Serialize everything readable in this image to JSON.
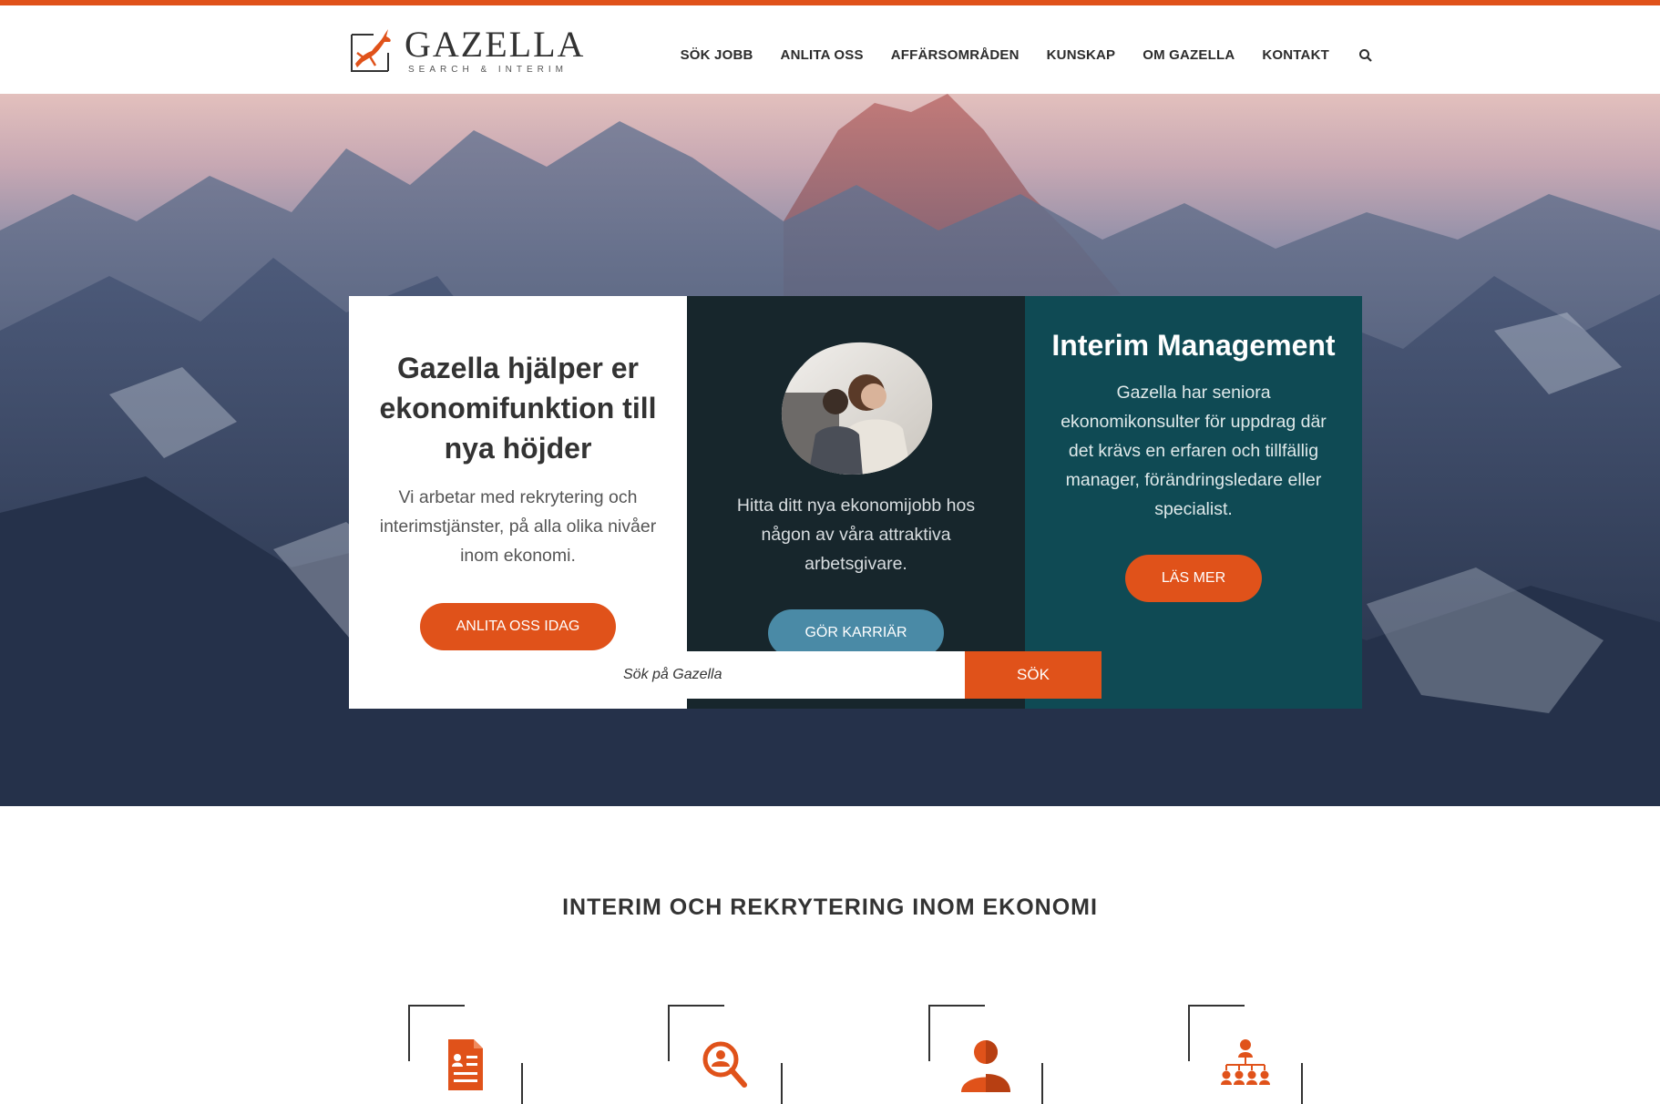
{
  "header": {
    "logo_name": "GAZELLA",
    "logo_sub": "SEARCH & INTERIM",
    "nav": [
      "SÖK JOBB",
      "ANLITA OSS",
      "AFFÄRSOMRÅDEN",
      "KUNSKAP",
      "OM GAZELLA",
      "KONTAKT"
    ],
    "search_icon": "search-icon"
  },
  "hero": {
    "card1": {
      "title": "Gazella hjälper er ekonomifunktion till nya höjder",
      "text": "Vi arbetar med rekrytering och interimstjänster, på alla olika nivåer inom ekonomi.",
      "button": "ANLITA OSS IDAG"
    },
    "card2": {
      "text": "Hitta ditt nya ekonomijobb hos någon av våra attraktiva arbetsgivare.",
      "button": "GÖR KARRIÄR"
    },
    "card3": {
      "title": "Interim Management",
      "text": "Gazella har seniora ekonomikonsulter för uppdrag där det krävs en erfaren och tillfällig manager, förändringsledare eller specialist.",
      "button": "LÄS MER"
    },
    "search": {
      "placeholder": "Sök på Gazella",
      "button": "SÖK"
    }
  },
  "section": {
    "title": "INTERIM OCH REKRYTERING INOM EKONOMI",
    "features": [
      {
        "icon": "document-icon"
      },
      {
        "icon": "person-search-icon"
      },
      {
        "icon": "person-icon"
      },
      {
        "icon": "org-chart-icon"
      }
    ]
  },
  "colors": {
    "accent": "#e0521a",
    "dark_card": "#17262c",
    "teal_card": "#0f4a54",
    "blue_button": "#4a8aa6"
  }
}
